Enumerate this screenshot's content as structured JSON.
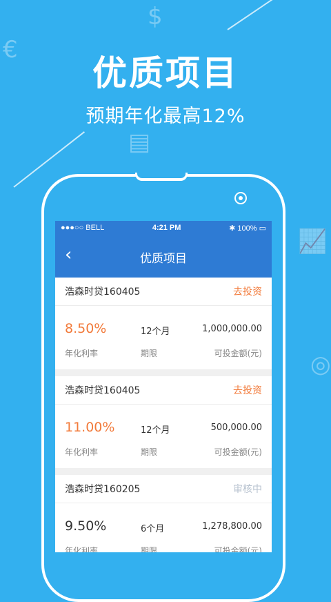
{
  "headline": "优质项目",
  "subheadline": "预期年化最高12%",
  "status_bar": {
    "carrier": "●●●○○ BELL",
    "time": "4:21 PM",
    "battery": "100%"
  },
  "nav": {
    "title": "优质项目",
    "back_icon": "chevron-left-icon"
  },
  "labels": {
    "rate": "年化利率",
    "term": "期限",
    "amount": "可投金额(元)"
  },
  "projects": [
    {
      "name": "浩森时贷160405",
      "action": "去投资",
      "rate": "8.50%",
      "term": "12个月",
      "amount": "1,000,000.00"
    },
    {
      "name": "浩森时贷160405",
      "action": "去投资",
      "rate": "11.00%",
      "term": "12个月",
      "amount": "500,000.00"
    },
    {
      "name": "浩森时贷160205",
      "action": "审核中",
      "rate": "9.50%",
      "term": "6个月",
      "amount": "1,278,800.00"
    }
  ],
  "colors": {
    "background": "#33b0ef",
    "nav": "#2e7bd4",
    "accent": "#f27a3a",
    "disabled": "#b7c2cf"
  }
}
